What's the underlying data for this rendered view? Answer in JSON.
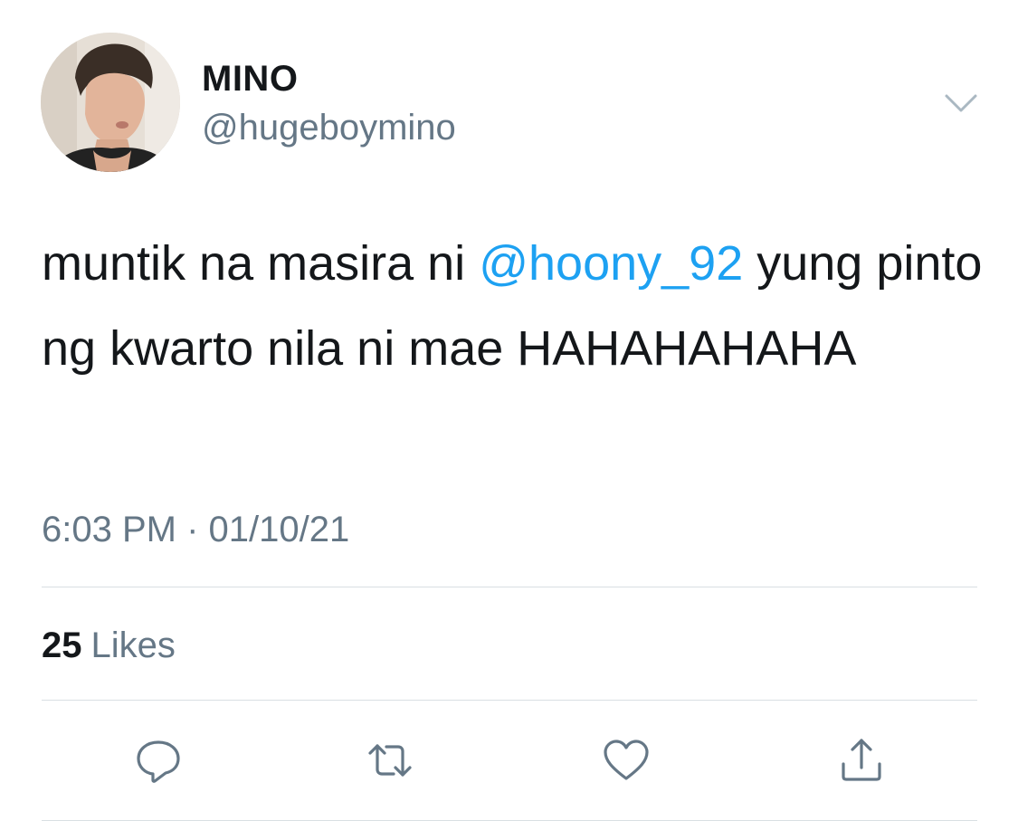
{
  "tweet": {
    "display_name": "MINO",
    "username": "@hugeboymino",
    "text_before": "muntik na masira ni ",
    "mention": "@hoony_92",
    "text_after": " yung pinto ng kwarto nila ni mae HAHAHAHAHA",
    "time": "6:03 PM",
    "separator": " · ",
    "date": "01/10/21",
    "likes_count": "25",
    "likes_label": "Likes"
  },
  "icons": {
    "menu": "chevron-down-icon",
    "reply": "reply-icon",
    "retweet": "retweet-icon",
    "like": "heart-icon",
    "share": "share-icon"
  },
  "colors": {
    "text_primary": "#14171a",
    "text_secondary": "#657786",
    "mention": "#1da1f2",
    "divider": "#d9dfe3"
  }
}
